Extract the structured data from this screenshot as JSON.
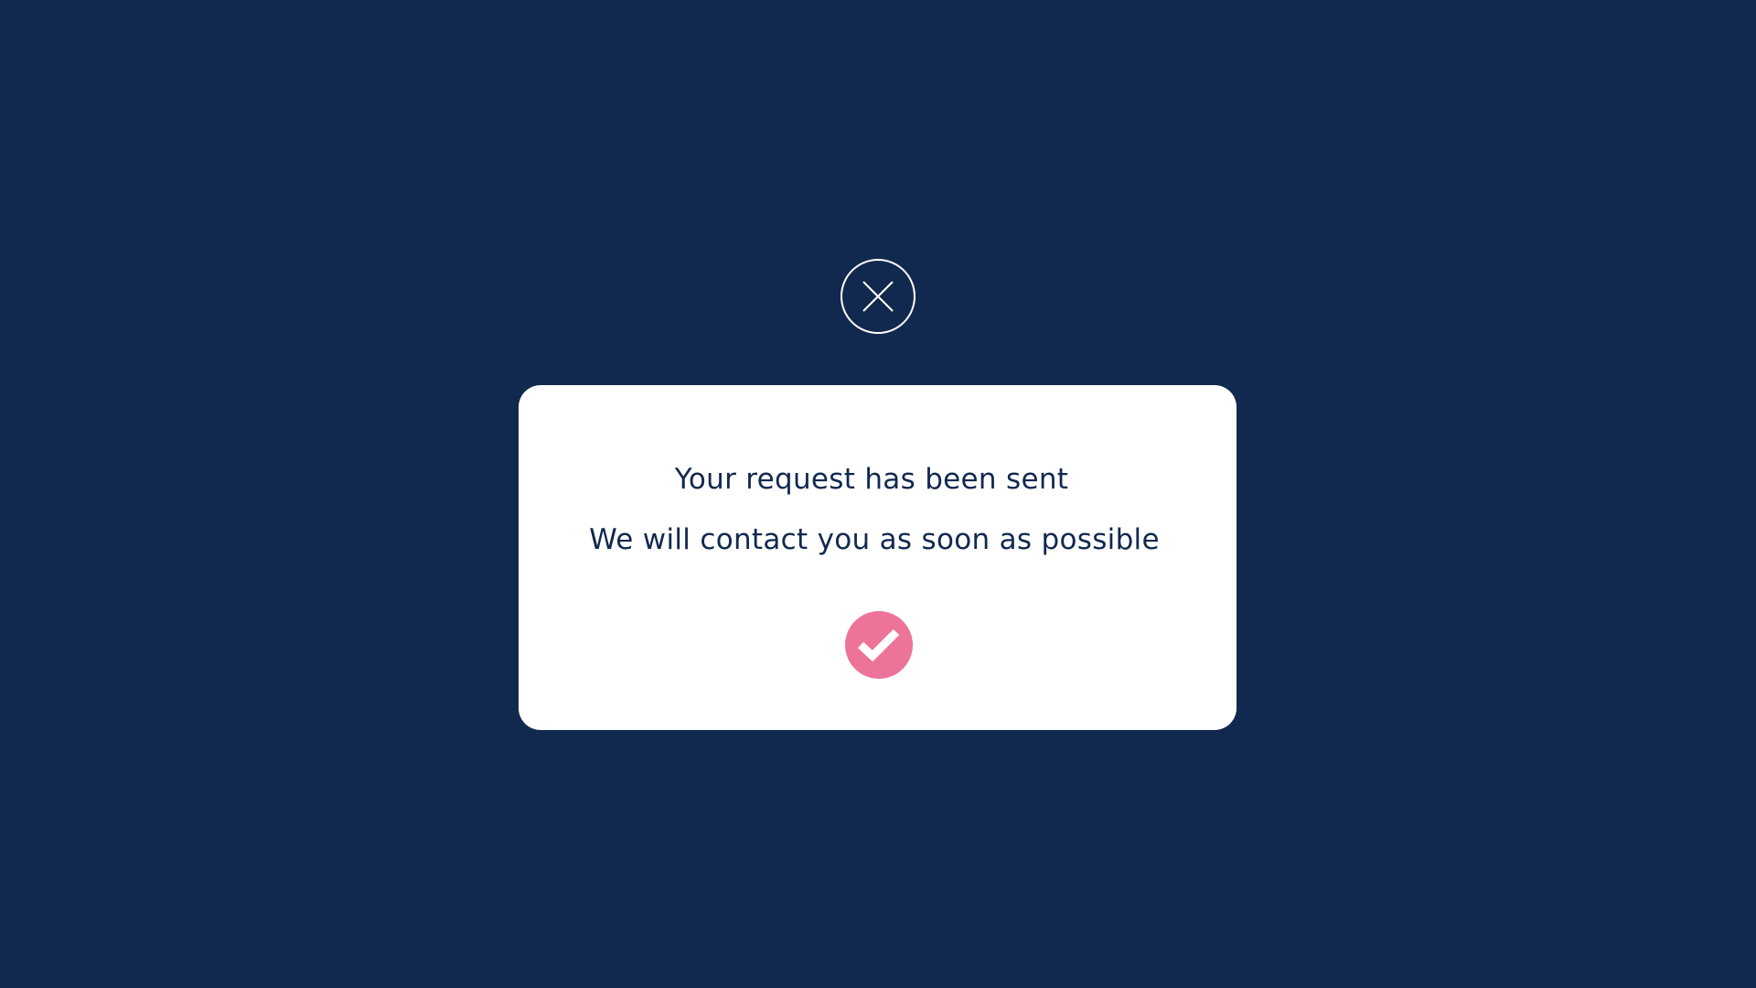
{
  "colors": {
    "background": "#12294f",
    "card": "#ffffff",
    "text": "#12294f",
    "accent": "#ee7399",
    "icon_stroke": "#ffffff"
  },
  "icons": {
    "close": "close-icon",
    "success": "checkmark-icon"
  },
  "modal": {
    "title": "Your request has been sent",
    "message": "We will contact you as soon as possible"
  }
}
